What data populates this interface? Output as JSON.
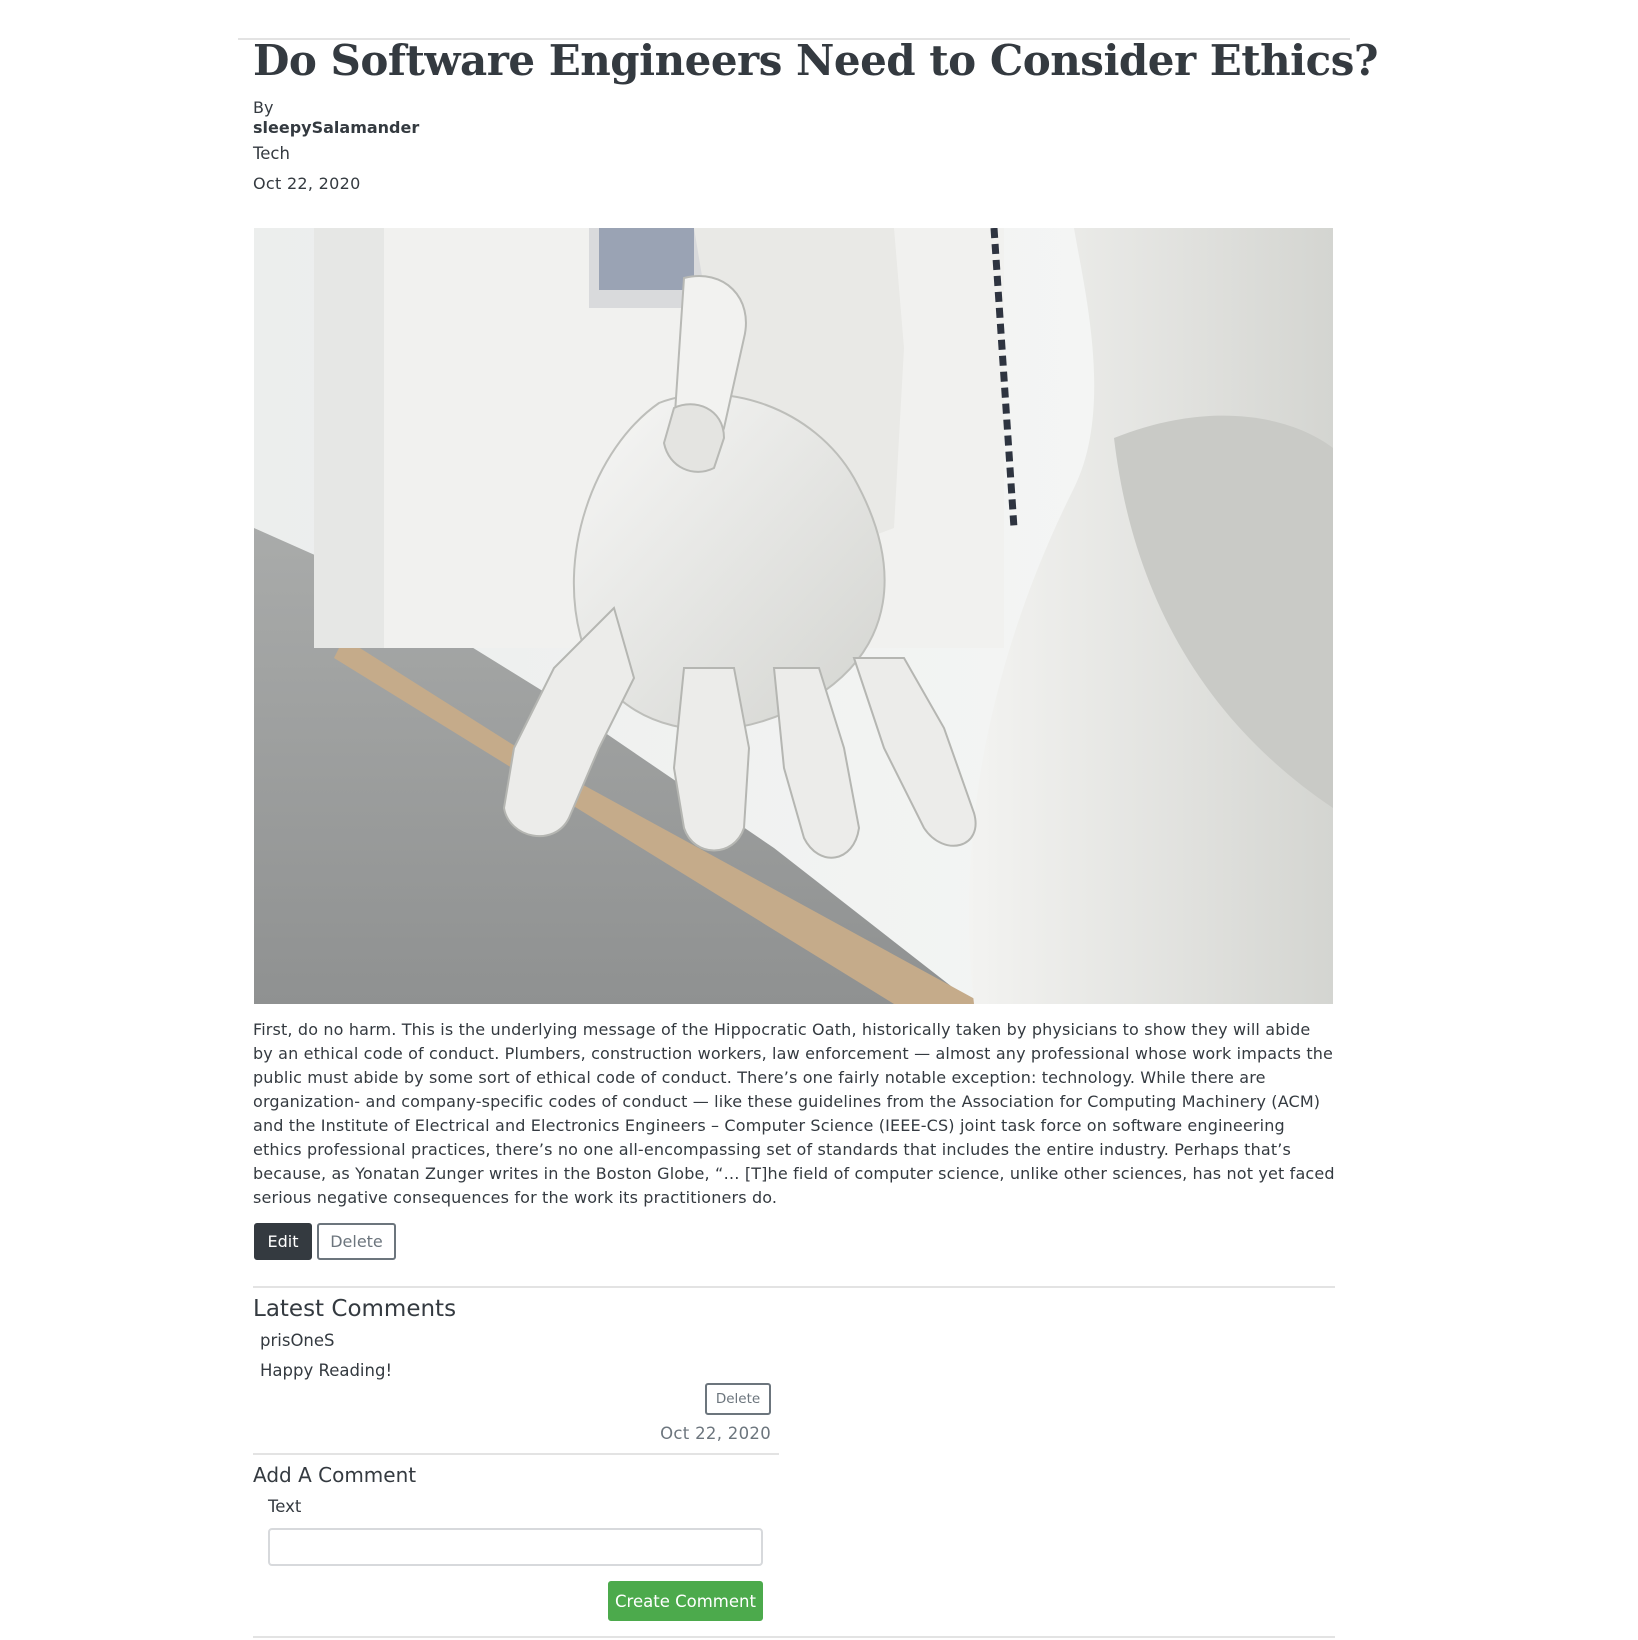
{
  "post": {
    "title": "Do Software Engineers Need to Consider Ethics?",
    "by_label": "By",
    "author": "sleepySalamander",
    "category": "Tech",
    "date": "Oct 22, 2020",
    "image_alt": "robot-hand-photo",
    "body": "First, do no harm. This is the underlying message of the Hippocratic Oath, historically taken by physicians to show they will abide by an ethical code of conduct. Plumbers, construction workers, law enforcement — almost any professional whose work impacts the public must abide by some sort of ethical code of conduct. There’s one fairly notable exception: technology. While there are organization- and company-specific codes of conduct — like these guidelines from the Association for Computing Machinery (ACM) and the Institute of Electrical and Electronics Engineers – Computer Science (IEEE-CS) joint task force on software engineering ethics professional practices, there’s no one all-encompassing set of standards that includes the entire industry. Perhaps that’s because, as Yonatan Zunger writes in the Boston Globe, “… [T]he field of computer science, unlike other sciences, has not yet faced serious negative consequences for the work its practitioners do.",
    "edit_label": "Edit",
    "delete_label": "Delete"
  },
  "comments": {
    "heading": "Latest Comments",
    "items": [
      {
        "author": "prisOneS",
        "text": "Happy Reading!",
        "delete_label": "Delete",
        "date": "Oct 22, 2020"
      }
    ]
  },
  "add_comment": {
    "heading": "Add A Comment",
    "text_label": "Text",
    "text_value": "",
    "submit_label": "Create Comment"
  },
  "colors": {
    "text": "#343a40",
    "muted": "#6c757d",
    "success": "#4caa4c",
    "rule": "#e3e3e3"
  }
}
